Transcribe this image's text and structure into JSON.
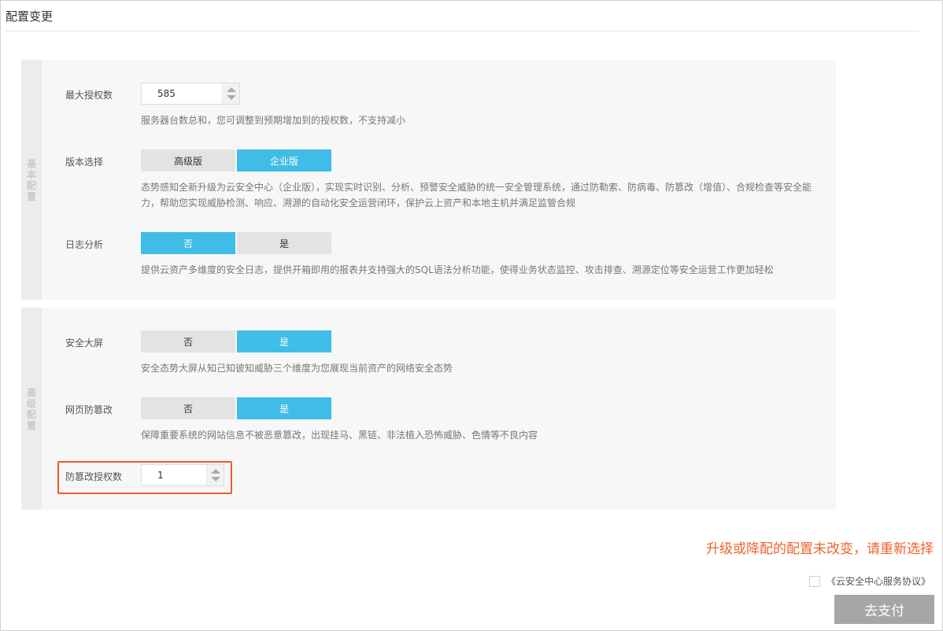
{
  "page": {
    "title": "配置变更"
  },
  "basic": {
    "side_label": "基本配置",
    "max_license": {
      "label": "最大授权数",
      "value": "585",
      "hint": "服务器台数总和，您可调整到预期增加到的授权数，不支持减小"
    },
    "edition": {
      "label": "版本选择",
      "options": [
        "高级版",
        "企业版"
      ],
      "selected": "企业版",
      "hint_line1": "态势感知全新升级为云安全中心（企业版），实现实时识别、分析、预警安全威胁的统一安全管理系统，通过防勒索、防病毒、防篡改（增值）、合规检查等安全能",
      "hint_line2": "力，帮助您实现威胁检测、响应、溯源的自动化安全运营闭环，保护云上资产和本地主机并满足监管合规"
    },
    "log_analysis": {
      "label": "日志分析",
      "options": [
        "否",
        "是"
      ],
      "selected": "否",
      "hint": "提供云资产多维度的安全日志，提供开箱即用的报表并支持强大的SQL语法分析功能，使得业务状态监控、攻击排查、溯源定位等安全运营工作更加轻松"
    }
  },
  "advanced": {
    "side_label": "高级配置",
    "big_screen": {
      "label": "安全大屏",
      "options": [
        "否",
        "是"
      ],
      "selected": "是",
      "hint": "安全态势大屏从知己知彼知威胁三个维度为您展现当前资产的网络安全态势"
    },
    "web_tamper": {
      "label": "网页防篡改",
      "options": [
        "否",
        "是"
      ],
      "selected": "是",
      "hint": "保障重要系统的网站信息不被恶意篡改，出现挂马、黑链、非法植入恐怖威胁、色情等不良内容"
    },
    "tamper_license": {
      "label": "防篡改授权数",
      "value": "1"
    }
  },
  "footer": {
    "warning": "升级或降配的配置未改变，请重新选择",
    "agreement": "《云安全中心服务协议》",
    "pay_button": "去支付"
  },
  "colors": {
    "selected_option": "#3fbde6",
    "warning": "#f0622b",
    "highlight_box": "#f05a28",
    "pay_button_disabled": "#a6a6a6"
  }
}
